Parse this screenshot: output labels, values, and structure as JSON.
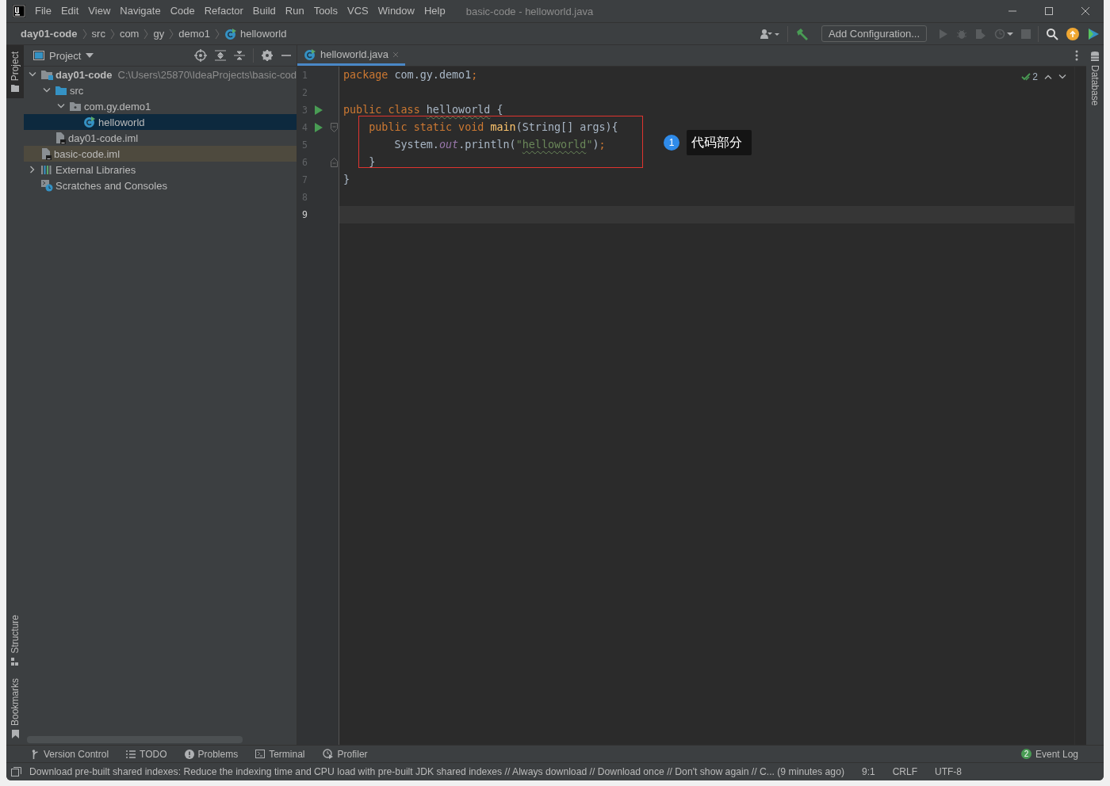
{
  "window": {
    "title": "basic-code - helloworld.java",
    "menu": [
      "File",
      "Edit",
      "View",
      "Navigate",
      "Code",
      "Refactor",
      "Build",
      "Run",
      "Tools",
      "VCS",
      "Window",
      "Help"
    ]
  },
  "breadcrumbs": [
    {
      "label": "day01-code",
      "kind": "project"
    },
    {
      "label": "src",
      "kind": "folder"
    },
    {
      "label": "com",
      "kind": "folder"
    },
    {
      "label": "gy",
      "kind": "folder"
    },
    {
      "label": "demo1",
      "kind": "folder"
    },
    {
      "label": "helloworld",
      "kind": "class"
    }
  ],
  "toolbar": {
    "run_config": "Add Configuration..."
  },
  "side_tabs_left": [
    {
      "label": "Project",
      "kind": "folder",
      "selected": true
    },
    {
      "label": "Structure",
      "kind": "structure",
      "selected": false
    },
    {
      "label": "Bookmarks",
      "kind": "bookmark",
      "selected": false
    }
  ],
  "side_tabs_right": [
    {
      "label": "Database",
      "kind": "database",
      "selected": false
    }
  ],
  "project_panel": {
    "title": "Project",
    "tree": [
      {
        "label": "day01-code",
        "path": "C:\\Users\\25870\\IdeaProjects\\basic-cod",
        "kind": "module",
        "expanded": true,
        "selected": false,
        "highlighted": false,
        "children": [
          {
            "label": "src",
            "kind": "folder",
            "expanded": true,
            "selected": false,
            "highlighted": false,
            "children": [
              {
                "label": "com.gy.demo1",
                "kind": "package",
                "expanded": true,
                "selected": false,
                "highlighted": false,
                "children": [
                  {
                    "label": "helloworld",
                    "kind": "class",
                    "selected": true,
                    "highlighted": false
                  }
                ]
              }
            ]
          },
          {
            "label": "day01-code.iml",
            "kind": "file",
            "selected": false,
            "highlighted": false
          }
        ]
      },
      {
        "label": "basic-code.iml",
        "kind": "file",
        "selected": false,
        "highlighted": true
      },
      {
        "label": "External Libraries",
        "kind": "libraries",
        "expanded": false,
        "selected": false,
        "highlighted": false
      },
      {
        "label": "Scratches and Consoles",
        "kind": "scratches",
        "selected": false,
        "highlighted": false
      }
    ]
  },
  "editor": {
    "tabs": [
      {
        "label": "helloworld.java",
        "selected": true
      }
    ],
    "inspection_count": "2",
    "lines": [
      {
        "number": "1",
        "run": false,
        "fold_start": false,
        "fold_end": false,
        "current": false,
        "tokens": [
          {
            "kind": "keyword",
            "text": "package"
          },
          {
            "kind": "plain",
            "text": " com.gy.demo1"
          },
          {
            "kind": "keyword",
            "text": ";"
          }
        ]
      },
      {
        "number": "2",
        "run": false,
        "fold_start": false,
        "fold_end": false,
        "current": false
      },
      {
        "number": "3",
        "run": true,
        "fold_start": false,
        "fold_end": false,
        "current": false,
        "tokens": [
          {
            "kind": "keyword",
            "text": "public class "
          },
          {
            "kind": "typo",
            "text": "helloworld"
          },
          {
            "kind": "plain",
            "text": " {"
          }
        ]
      },
      {
        "number": "4",
        "run": true,
        "fold_start": true,
        "fold_end": false,
        "current": false,
        "tokens": [
          {
            "kind": "keyword",
            "text": "    public static void "
          },
          {
            "kind": "method",
            "text": "main"
          },
          {
            "kind": "plain",
            "text": "(String[] args){"
          }
        ]
      },
      {
        "number": "5",
        "run": false,
        "fold_start": false,
        "fold_end": false,
        "current": false,
        "tokens": [
          {
            "kind": "plain",
            "text": "        System."
          },
          {
            "kind": "field",
            "text": "out"
          },
          {
            "kind": "plain",
            "text": ".println("
          },
          {
            "kind": "string",
            "text": "\""
          },
          {
            "kind": "string-typo",
            "text": "helloworld"
          },
          {
            "kind": "string",
            "text": "\""
          },
          {
            "kind": "plain",
            "text": ")"
          },
          {
            "kind": "keyword",
            "text": ";"
          }
        ]
      },
      {
        "number": "6",
        "run": false,
        "fold_start": false,
        "fold_end": true,
        "current": false,
        "tokens": [
          {
            "kind": "plain",
            "text": "    }"
          }
        ]
      },
      {
        "number": "7",
        "run": false,
        "fold_start": false,
        "fold_end": false,
        "current": false,
        "tokens": [
          {
            "kind": "plain",
            "text": "}"
          }
        ]
      },
      {
        "number": "8",
        "run": false,
        "fold_start": false,
        "fold_end": false,
        "current": false
      },
      {
        "number": "9",
        "run": false,
        "fold_start": false,
        "fold_end": false,
        "current": true
      }
    ],
    "annotation": {
      "number": "1",
      "text": "代码部分"
    }
  },
  "tool_windows": [
    {
      "label": "Version Control",
      "kind": "vcs"
    },
    {
      "label": "TODO",
      "kind": "todo"
    },
    {
      "label": "Problems",
      "kind": "problems"
    },
    {
      "label": "Terminal",
      "kind": "terminal"
    },
    {
      "label": "Profiler",
      "kind": "profiler"
    }
  ],
  "event_log": {
    "count": "2",
    "label": "Event Log"
  },
  "status": {
    "message": "Download pre-built shared indexes: Reduce the indexing time and CPU load with pre-built JDK shared indexes // Always download // Download once // Don't show again // C... (9 minutes ago)",
    "position": "9:1",
    "line_separator": "CRLF",
    "encoding": "UTF-8"
  }
}
